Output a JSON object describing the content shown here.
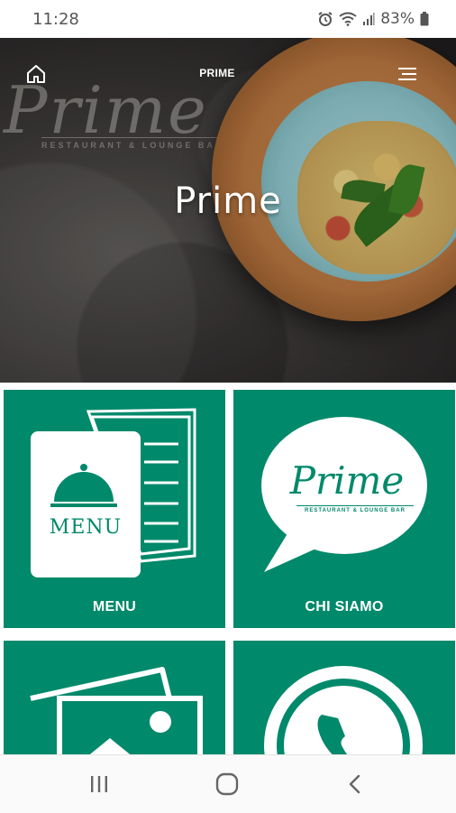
{
  "status_bar": {
    "time": "11:28",
    "battery_percent": "83%",
    "icons": [
      "alarm-icon",
      "wifi-icon",
      "signal-icon",
      "battery-icon"
    ]
  },
  "header": {
    "title": "PRIME",
    "home_icon": "home-icon",
    "menu_icon": "hamburger-menu-icon"
  },
  "hero": {
    "title": "Prime",
    "logo_text": "Prime",
    "logo_subtitle": "RESTAURANT & LOUNGE BAR"
  },
  "tiles": [
    {
      "label": "MENU",
      "icon": "menu-card-icon",
      "icon_text": "MENU"
    },
    {
      "label": "CHI SIAMO",
      "icon": "speech-bubble-logo-icon",
      "icon_text": "Prime",
      "icon_subtext": "RESTAURANT & LOUNGE BAR"
    },
    {
      "label": "",
      "icon": "gallery-icon"
    },
    {
      "label": "",
      "icon": "whatsapp-icon"
    }
  ],
  "nav_bar": {
    "icons": [
      "recent-apps-icon",
      "home-circle-icon",
      "back-icon"
    ]
  },
  "colors": {
    "tile_green": "#00896a",
    "white": "#ffffff"
  }
}
